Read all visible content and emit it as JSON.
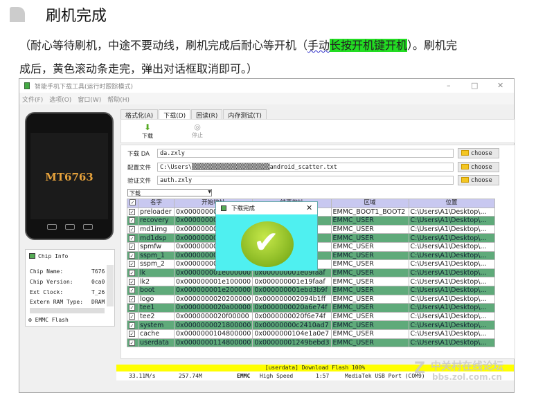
{
  "doc": {
    "heading": "刷机完成",
    "para1_a": "（耐心等待刷机，中途不要动线，刷机完成后耐心等开机（",
    "para1_u": "手动",
    "para1_hl": "长按开机键开机",
    "para1_b": "）。刷机完",
    "para2": "成后，黄色滚动条走完，弹出对话框取消即可。）",
    "highlight_color": "#22dd22"
  },
  "window": {
    "title": "智能手机下载工具(运行时跟踪模式)",
    "menu": [
      "文件(F)",
      "选项(O)",
      "窗口(W)",
      "帮助(H)"
    ],
    "controls": [
      "–",
      "□",
      "✕"
    ]
  },
  "phone": {
    "model": "MT6763"
  },
  "chip_info": {
    "title": "Chip Info",
    "rows": [
      {
        "label": "Chip Name:",
        "value": "T676"
      },
      {
        "label": "Chip Version:",
        "value": "0ca0"
      },
      {
        "label": "Ext Clock:",
        "value": "T_26"
      },
      {
        "label": "Extern RAM Type:",
        "value": "DRAM"
      }
    ],
    "storage": "EMMC Flash"
  },
  "tabs": [
    "格式化(A)",
    "下载(D)",
    "回读(R)",
    "内存测试(T)"
  ],
  "toolbar": {
    "download": "下载",
    "stop": "停止"
  },
  "form": {
    "da_label": "下载 DA",
    "da_value": "da.zxly",
    "scatter_label": "配置文件",
    "scatter_value": "C:\\Users\\▒▒▒▒▒▒▒▒▒▒▒▒▒▒▒▒▒▒▒▒▒▒android_scatter.txt",
    "auth_label": "验证文件",
    "auth_value": "auth.zxly",
    "choose": "choose",
    "mode": "下载"
  },
  "table": {
    "headers": [
      "名字",
      "开始地址",
      "结束地址",
      "区域",
      "位置"
    ],
    "rows": [
      [
        "preloader",
        "0x00000000",
        "…93",
        "EMMC_BOOT1_BOOT2",
        "C:\\Users\\A1\\Desktop\\..."
      ],
      [
        "recovery",
        "0x00000000",
        "…9f",
        "EMMC_USER",
        "C:\\Users\\A1\\Desktop\\..."
      ],
      [
        "md1img",
        "0x00000000",
        "…df",
        "EMMC_USER",
        "C:\\Users\\A1\\Desktop\\..."
      ],
      [
        "md1dsp",
        "0x00000000",
        "…3f",
        "EMMC_USER",
        "C:\\Users\\A1\\Desktop\\..."
      ],
      [
        "spmfw",
        "0x00000000",
        "…3f",
        "EMMC_USER",
        "C:\\Users\\A1\\Desktop\\..."
      ],
      [
        "sspm_1",
        "0x00000000",
        "…4f",
        "EMMC_USER",
        "C:\\Users\\A1\\Desktop\\..."
      ],
      [
        "sspm_2",
        "0x00000000",
        "…4f",
        "EMMC_USER",
        "C:\\Users\\A1\\Desktop\\..."
      ],
      [
        "lk",
        "0x000000001e000000",
        "0x000000001e09faaf",
        "EMMC_USER",
        "C:\\Users\\A1\\Desktop\\..."
      ],
      [
        "lk2",
        "0x000000001e100000",
        "0x000000001e19faaf",
        "EMMC_USER",
        "C:\\Users\\A1\\Desktop\\..."
      ],
      [
        "boot",
        "0x000000001e200000",
        "0x000000001ebd3b9f",
        "EMMC_USER",
        "C:\\Users\\A1\\Desktop\\..."
      ],
      [
        "logo",
        "0x0000000020200000",
        "0x000000002094b1ff",
        "EMMC_USER",
        "C:\\Users\\A1\\Desktop\\..."
      ],
      [
        "tee1",
        "0x0000000020a00000",
        "0x0000000020a6e74f",
        "EMMC_USER",
        "C:\\Users\\A1\\Desktop\\..."
      ],
      [
        "tee2",
        "0x0000000020f00000",
        "0x0000000020f6e74f",
        "EMMC_USER",
        "C:\\Users\\A1\\Desktop\\..."
      ],
      [
        "system",
        "0x0000000021800000",
        "0x00000000c2410ad7",
        "EMMC_USER",
        "C:\\Users\\A1\\Desktop\\..."
      ],
      [
        "cache",
        "0x0000000104800000",
        "0x0000000104e1a0e7",
        "EMMC_USER",
        "C:\\Users\\A1\\Desktop\\..."
      ],
      [
        "userdata",
        "0x0000000114800000",
        "0x00000001249bebd3",
        "EMMC_USER",
        "C:\\Users\\A1\\Desktop\\..."
      ]
    ]
  },
  "dialog": {
    "title": "下载完成",
    "close": "✕"
  },
  "progress": {
    "text": "[userdata] Download Flash 100%",
    "percent": 100
  },
  "status": {
    "speed": "33.11M/s",
    "size": "257.74M",
    "storage": "EMMC",
    "usb": "High Speed",
    "time": "1:57",
    "port": "MediaTek USB Port (COM9)"
  },
  "watermark": {
    "line1": "中关村在线论坛",
    "line2": "bbs.zol.com.cn"
  }
}
